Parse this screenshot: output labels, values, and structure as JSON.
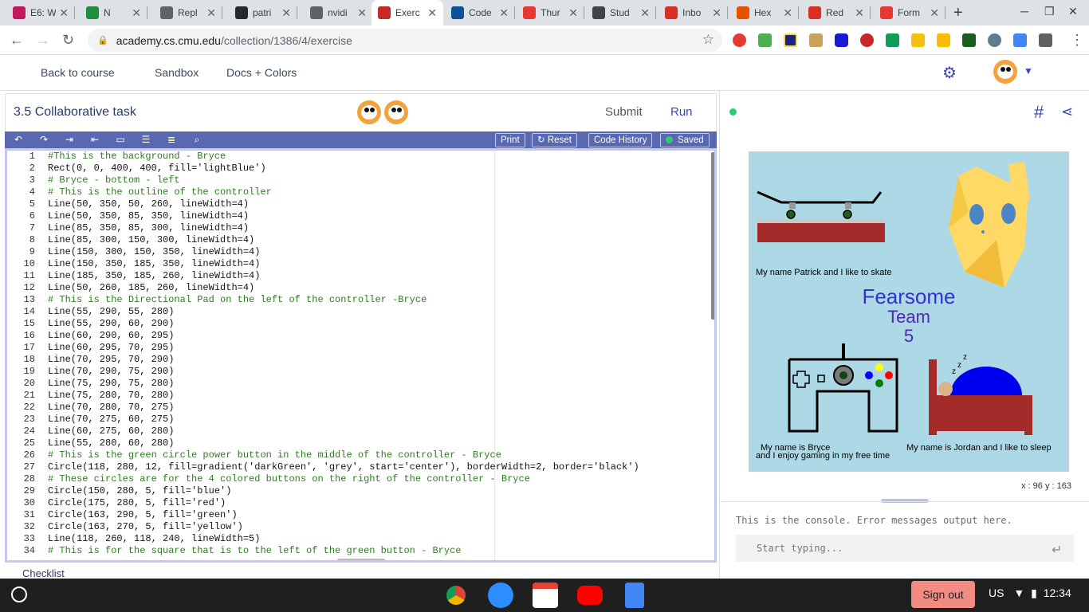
{
  "browser": {
    "tabs": [
      {
        "title": "E6: W",
        "favicon_color": "#c2185b",
        "active": false
      },
      {
        "title": "N",
        "favicon_color": "#1e8e3e",
        "active": false
      },
      {
        "title": "Repl",
        "favicon_color": "#5f6368",
        "active": false
      },
      {
        "title": "patri",
        "favicon_color": "#24292e",
        "active": false
      },
      {
        "title": "nvidi",
        "favicon_color": "#5f6368",
        "active": false
      },
      {
        "title": "Exerc",
        "favicon_color": "#c62828",
        "active": true
      },
      {
        "title": "Code",
        "favicon_color": "#0b5394",
        "active": false
      },
      {
        "title": "Thur",
        "favicon_color": "#e53935",
        "active": false
      },
      {
        "title": "Stud",
        "favicon_color": "#444444",
        "active": false
      },
      {
        "title": "Inbo",
        "favicon_color": "#d93025",
        "active": false
      },
      {
        "title": "Hex",
        "favicon_color": "#e65100",
        "active": false
      },
      {
        "title": "Red",
        "favicon_color": "#d93025",
        "active": false
      },
      {
        "title": "Form",
        "favicon_color": "#e53935",
        "active": false
      }
    ],
    "new_tab": "+",
    "url_host": "academy.cs.cmu.edu",
    "url_path": "/collection/1386/4/exercise"
  },
  "nav": {
    "back": "Back to course",
    "sandbox": "Sandbox",
    "docs": "Docs + Colors"
  },
  "task": {
    "title": "3.5 Collaborative task",
    "submit": "Submit",
    "run": "Run"
  },
  "editor_toolbar": {
    "print": "Print",
    "reset": "Reset",
    "history": "Code History",
    "saved": "Saved"
  },
  "code_lines": [
    "#This is the background - Bryce",
    "Rect(0, 0, 400, 400, fill='lightBlue')",
    "# Bryce - bottom - left",
    "# This is the outline of the controller",
    "Line(50, 350, 50, 260, lineWidth=4)",
    "Line(50, 350, 85, 350, lineWidth=4)",
    "Line(85, 350, 85, 300, lineWidth=4)",
    "Line(85, 300, 150, 300, lineWidth=4)",
    "Line(150, 300, 150, 350, lineWidth=4)",
    "Line(150, 350, 185, 350, lineWidth=4)",
    "Line(185, 350, 185, 260, lineWidth=4)",
    "Line(50, 260, 185, 260, lineWidth=4)",
    "# This is the Directional Pad on the left of the controller -Bryce",
    "Line(55, 290, 55, 280)",
    "Line(55, 290, 60, 290)",
    "Line(60, 290, 60, 295)",
    "Line(60, 295, 70, 295)",
    "Line(70, 295, 70, 290)",
    "Line(70, 290, 75, 290)",
    "Line(75, 290, 75, 280)",
    "Line(75, 280, 70, 280)",
    "Line(70, 280, 70, 275)",
    "Line(70, 275, 60, 275)",
    "Line(60, 275, 60, 280)",
    "Line(55, 280, 60, 280)",
    "# This is the green circle power button in the middle of the controller - Bryce",
    "Circle(118, 280, 12, fill=gradient('darkGreen', 'grey', start='center'), borderWidth=2, border='black')",
    "# These circles are for the 4 colored buttons on the right of the controller - Bryce",
    "Circle(150, 280, 5, fill='blue')",
    "Circle(175, 280, 5, fill='red')",
    "Circle(163, 290, 5, fill='green')",
    "Circle(163, 270, 5, fill='yellow')",
    "Line(118, 260, 118, 240, lineWidth=5)",
    "# This is for the square that is to the left of the green button - Bryce"
  ],
  "canvas": {
    "patrick_caption": "My name Patrick and I like to skate",
    "title_line1": "Fearsome",
    "title_line2": "Team",
    "title_line3": "5",
    "bryce_caption_1": "My name is Bryce",
    "bryce_caption_2": "and I enjoy gaming in my free time",
    "jordan_caption": "My name is Jordan and I like to sleep",
    "zzz": "z",
    "background_color": "#add8e6"
  },
  "coords": "x : 96 y : 163",
  "console": {
    "message": "This is the console. Error messages output here.",
    "placeholder": "Start typing..."
  },
  "checklist": "Checklist",
  "shelf": {
    "sign_out": "Sign out",
    "locale": "US",
    "time": "12:34"
  }
}
